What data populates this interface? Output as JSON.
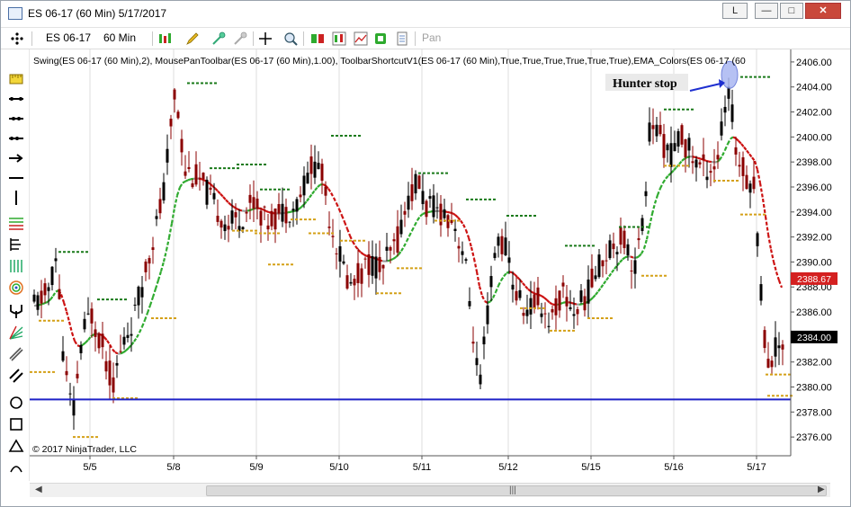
{
  "window": {
    "title": "ES 06-17 (60 Min)  5/17/2017",
    "buttons": {
      "layout": "L",
      "minimize": "—",
      "maximize": "□",
      "close": "✕"
    }
  },
  "toolbar": {
    "instrument": "ES 06-17",
    "interval": "60 Min",
    "pan_label": "Pan",
    "icons": [
      "crosshair-icon",
      "bar-type-icon",
      "drawing-pencil-icon",
      "zoom-in-icon",
      "zoom-out-icon",
      "cursor-icon",
      "zoom-rect-icon",
      "data-box-icon",
      "strategies-icon",
      "indicators-icon",
      "properties-icon",
      "templates-icon",
      "pan-icon"
    ]
  },
  "left_tools": [
    "ruler-icon",
    "risk-reward-icon",
    "extended-line-icon",
    "ray-icon",
    "arrow-line-icon",
    "horizontal-line-icon",
    "vertical-line-icon",
    "fib-retracement-icon",
    "fib-extension-icon",
    "fib-timezone-icon",
    "fib-circle-icon",
    "andrews-pitchfork-icon",
    "gann-fan-icon",
    "regression-channel-icon",
    "trend-channel-icon",
    "ellipse-icon",
    "rectangle-icon",
    "triangle-icon",
    "arc-icon"
  ],
  "chart_data": {
    "type": "candlestick",
    "indicator_label": "Swing(ES 06-17 (60 Min),2), MousePanToolbar(ES 06-17 (60 Min),1.00), ToolbarShortcutV1(ES 06-17 (60 Min),True,True,True,True,True,True),EMA_Colors(ES 06-17 (60",
    "annotation": "Hunter stop",
    "copyright": "© 2017 NinjaTrader, LLC",
    "ylim": [
      2374.5,
      2407.0
    ],
    "y_ticks": [
      2376,
      2378,
      2380,
      2382,
      2384,
      2386,
      2388,
      2390,
      2392,
      2394,
      2396,
      2398,
      2400,
      2402,
      2404,
      2406
    ],
    "y_tick_labels": [
      "2376.00",
      "2378.00",
      "2380.00",
      "2382.00",
      "2384.00",
      "2386.00",
      "2388.00",
      "2390.00",
      "2392.00",
      "2394.00",
      "2396.00",
      "2398.00",
      "2400.00",
      "2402.00",
      "2404.00",
      "2406.00"
    ],
    "x_labels": [
      "5/5",
      "5/8",
      "5/9",
      "5/10",
      "5/11",
      "5/12",
      "5/15",
      "5/16",
      "5/17"
    ],
    "last_price_label": "2384.00",
    "last_price": 2384.0,
    "ema_value_label": "2388.67",
    "ema_value": 2388.67,
    "support_level": 2379.0,
    "hunter_stop_level": 2404.75,
    "colors": {
      "up_candle": "#000000",
      "down_candle": "#8b0000",
      "ema_up": "#2eaa2e",
      "ema_down": "#cc1111",
      "ema_flat": "#9a9a9a",
      "swing_high": "#1a7a1a",
      "swing_low": "#d4a017",
      "support_line": "#1f22c8",
      "annotation_ellipse": "#9aa9ee",
      "price_marker": "#d42020"
    },
    "swing_highs": [
      {
        "x": 32,
        "y": 2390.8
      },
      {
        "x": 75,
        "y": 2387.0
      },
      {
        "x": 175,
        "y": 2404.3
      },
      {
        "x": 200,
        "y": 2397.5
      },
      {
        "x": 230,
        "y": 2397.8
      },
      {
        "x": 256,
        "y": 2395.8
      },
      {
        "x": 335,
        "y": 2400.1
      },
      {
        "x": 432,
        "y": 2397.1
      },
      {
        "x": 485,
        "y": 2395.0
      },
      {
        "x": 530,
        "y": 2393.7
      },
      {
        "x": 595,
        "y": 2391.3
      },
      {
        "x": 655,
        "y": 2392.8
      },
      {
        "x": 705,
        "y": 2402.2
      },
      {
        "x": 790,
        "y": 2404.8
      }
    ],
    "swing_lows": [
      {
        "x": 0,
        "y": 2381.2
      },
      {
        "x": 10,
        "y": 2385.3
      },
      {
        "x": 48,
        "y": 2376.0
      },
      {
        "x": 92,
        "y": 2379.1
      },
      {
        "x": 135,
        "y": 2385.5
      },
      {
        "x": 225,
        "y": 2392.5
      },
      {
        "x": 250,
        "y": 2392.3
      },
      {
        "x": 265,
        "y": 2389.8
      },
      {
        "x": 290,
        "y": 2393.4
      },
      {
        "x": 310,
        "y": 2392.3
      },
      {
        "x": 345,
        "y": 2391.7
      },
      {
        "x": 385,
        "y": 2387.5
      },
      {
        "x": 408,
        "y": 2389.5
      },
      {
        "x": 450,
        "y": 2393.3
      },
      {
        "x": 545,
        "y": 2386.3
      },
      {
        "x": 578,
        "y": 2384.5
      },
      {
        "x": 620,
        "y": 2385.5
      },
      {
        "x": 680,
        "y": 2388.9
      },
      {
        "x": 705,
        "y": 2397.7
      },
      {
        "x": 760,
        "y": 2396.5
      },
      {
        "x": 790,
        "y": 2393.8
      },
      {
        "x": 818,
        "y": 2381.0
      },
      {
        "x": 820,
        "y": 2379.3
      }
    ]
  }
}
